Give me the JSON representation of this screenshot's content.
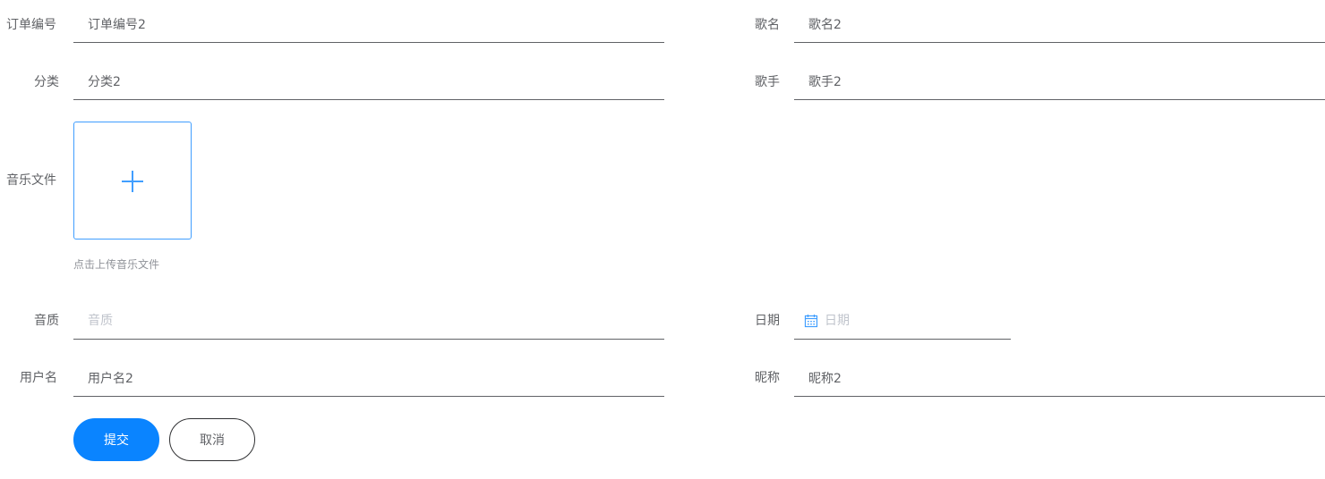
{
  "form": {
    "order_no": {
      "label": "订单编号",
      "value": "订单编号2",
      "placeholder": "订单编号"
    },
    "song_name": {
      "label": "歌名",
      "value": "歌名2",
      "placeholder": "歌名"
    },
    "category": {
      "label": "分类",
      "value": "分类2",
      "placeholder": "分类"
    },
    "singer": {
      "label": "歌手",
      "value": "歌手2",
      "placeholder": "歌手"
    },
    "music_file": {
      "label": "音乐文件",
      "upload_tip": "点击上传音乐文件",
      "icon": "plus-icon"
    },
    "quality": {
      "label": "音质",
      "value": "",
      "placeholder": "音质"
    },
    "date": {
      "label": "日期",
      "value": "",
      "placeholder": "日期",
      "icon": "calendar-icon"
    },
    "username": {
      "label": "用户名",
      "value": "用户名2",
      "placeholder": "用户名"
    },
    "nickname": {
      "label": "昵称",
      "value": "昵称2",
      "placeholder": "昵称"
    }
  },
  "actions": {
    "submit_label": "提交",
    "cancel_label": "取消"
  },
  "colors": {
    "primary": "#0a84ff",
    "upload_border": "#409eff",
    "text": "#606266",
    "placeholder": "#c0c4cc"
  }
}
